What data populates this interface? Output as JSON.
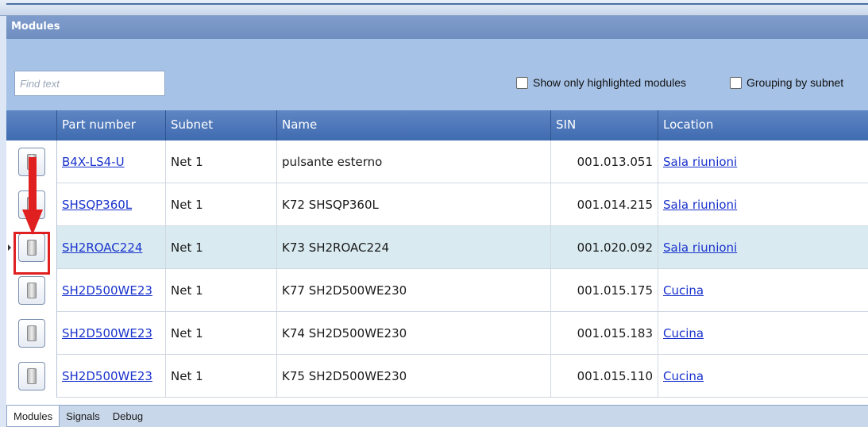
{
  "window": {
    "title": "Modules"
  },
  "toolbar": {
    "search_placeholder": "Find text",
    "show_highlighted_label": "Show only highlighted modules",
    "grouping_label": "Grouping by subnet"
  },
  "columns": {
    "part": "Part number",
    "subnet": "Subnet",
    "name": "Name",
    "sin": "SIN",
    "location": "Location"
  },
  "rows": [
    {
      "part": "B4X-LS4-U",
      "subnet": "Net 1",
      "name": "pulsante esterno",
      "sin": "001.013.051",
      "location": "Sala riunioni"
    },
    {
      "part": "SHSQP360L",
      "subnet": "Net 1",
      "name": "K72 SHSQP360L",
      "sin": "001.014.215",
      "location": "Sala riunioni"
    },
    {
      "part": "SH2ROAC224",
      "subnet": "Net 1",
      "name": "K73 SH2ROAC224",
      "sin": "001.020.092",
      "location": "Sala riunioni"
    },
    {
      "part": "SH2D500WE23",
      "subnet": "Net 1",
      "name": "K77 SH2D500WE230",
      "sin": "001.015.175",
      "location": "Cucina"
    },
    {
      "part": "SH2D500WE23",
      "subnet": "Net 1",
      "name": "K74 SH2D500WE230",
      "sin": "001.015.183",
      "location": "Cucina"
    },
    {
      "part": "SH2D500WE23",
      "subnet": "Net 1",
      "name": "K75 SH2D500WE230",
      "sin": "001.015.110",
      "location": "Cucina"
    }
  ],
  "selected_row": 2,
  "tabs": [
    "Modules",
    "Signals",
    "Debug"
  ],
  "active_tab": 0,
  "colors": {
    "header": "#4a76ba",
    "selected_row": "#d9ebf1",
    "annotation": "#e02020"
  }
}
